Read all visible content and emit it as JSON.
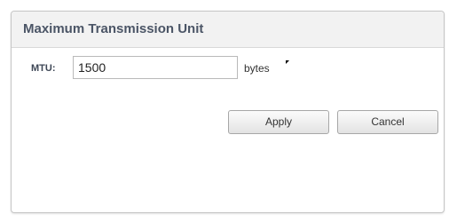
{
  "panel": {
    "title": "Maximum Transmission Unit"
  },
  "mtu": {
    "label": "MTU:",
    "value": "1500",
    "unit": "bytes"
  },
  "buttons": {
    "apply": "Apply",
    "cancel": "Cancel"
  }
}
